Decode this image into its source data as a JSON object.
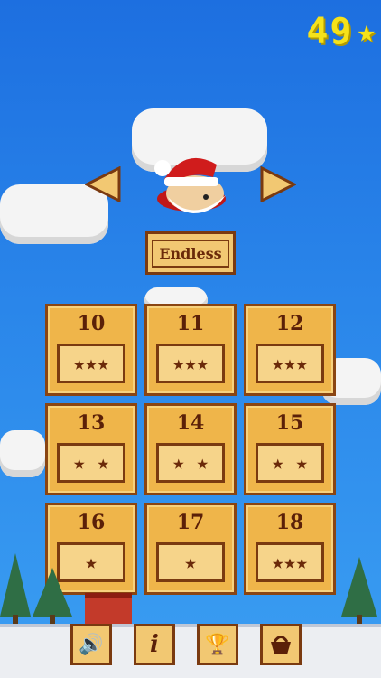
{
  "hud": {
    "total_stars": "49",
    "star_icon": "star-icon"
  },
  "mode": {
    "endless_label": "Endless"
  },
  "levels": [
    {
      "number": "10",
      "stars": "★★★"
    },
    {
      "number": "11",
      "stars": "★★★"
    },
    {
      "number": "12",
      "stars": "★★★"
    },
    {
      "number": "13",
      "stars": "★  ★"
    },
    {
      "number": "14",
      "stars": "★  ★"
    },
    {
      "number": "15",
      "stars": "★  ★"
    },
    {
      "number": "16",
      "stars": "★"
    },
    {
      "number": "17",
      "stars": "★"
    },
    {
      "number": "18",
      "stars": "★★★"
    }
  ],
  "toolbar": {
    "icons": [
      "speaker-icon",
      "info-icon",
      "trophy-icon",
      "basket-icon"
    ]
  },
  "colors": {
    "sky": "#2a86ea",
    "panel": "#efb54a",
    "border": "#7a3a10",
    "hud_yellow": "#f6e21a"
  }
}
